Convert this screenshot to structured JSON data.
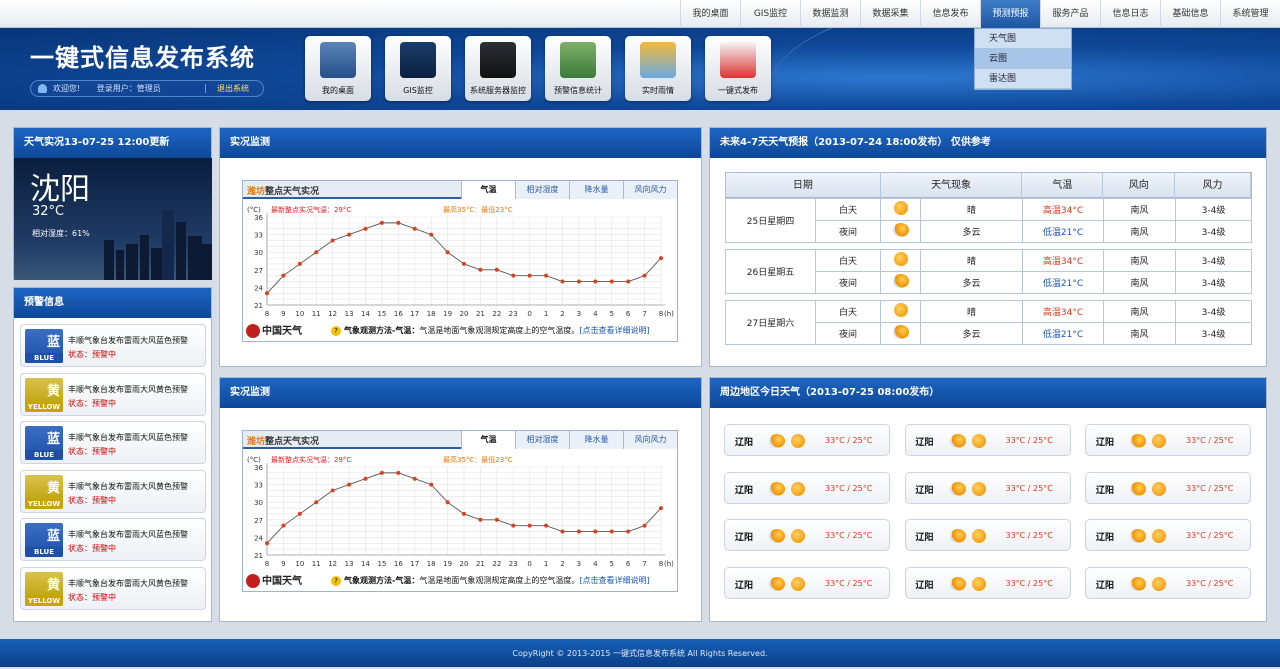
{
  "topnav": {
    "items": [
      "我的桌面",
      "GIS监控",
      "数据监测",
      "数据采集",
      "信息发布",
      "预测预报",
      "服务产品",
      "信息日志",
      "基础信息",
      "系统管理"
    ],
    "active_index": 5,
    "dropdown": [
      "天气图",
      "云图",
      "雷达图"
    ],
    "dropdown_selected_index": 1
  },
  "header": {
    "title": "一键式信息发布系统",
    "welcome": "欢迎您!",
    "user_label": "登录用户：管理员",
    "logout": "退出系统"
  },
  "tiles": [
    {
      "label": "我的桌面",
      "icon": "desktop-check-icon"
    },
    {
      "label": "GIS监控",
      "icon": "globe-map-icon"
    },
    {
      "label": "系统服务器监控",
      "icon": "server-monitor-icon"
    },
    {
      "label": "预警信息统计",
      "icon": "chart-stats-icon"
    },
    {
      "label": "实时雨情",
      "icon": "weather-rain-icon"
    },
    {
      "label": "一键式发布",
      "icon": "pencil-edit-icon"
    }
  ],
  "current": {
    "header": "天气实况13-07-25 12:00更新",
    "city": "沈阳",
    "temp": "32°C",
    "humidity": "相对湿度：61%"
  },
  "warnings": {
    "header": "预警信息",
    "items": [
      {
        "text": "丰顺气象台发布雷雨大风蓝色预警",
        "status": "状态：预警中",
        "level": "BLUE",
        "level_cn": "蓝"
      },
      {
        "text": "丰顺气象台发布雷雨大风黄色预警",
        "status": "状态：预警中",
        "level": "YELLOW",
        "level_cn": "黄"
      },
      {
        "text": "丰顺气象台发布雷雨大风蓝色预警",
        "status": "状态：预警中",
        "level": "BLUE",
        "level_cn": "蓝"
      },
      {
        "text": "丰顺气象台发布雷雨大风黄色预警",
        "status": "状态：预警中",
        "level": "YELLOW",
        "level_cn": "黄"
      },
      {
        "text": "丰顺气象台发布雷雨大风蓝色预警",
        "status": "状态：预警中",
        "level": "BLUE",
        "level_cn": "蓝"
      },
      {
        "text": "丰顺气象台发布雷雨大风黄色预警",
        "status": "状态：预警中",
        "level": "YELLOW",
        "level_cn": "黄"
      }
    ],
    "colors": {
      "BLUE": "#1d4fa8",
      "YELLOW": "#c9a400"
    }
  },
  "monitor": {
    "panels": [
      {
        "header": "实况监测",
        "chart_title_city": "潍坊",
        "chart_title_rest": "整点天气实况",
        "tabs": [
          "气温",
          "相对湿度",
          "降水量",
          "风向风力"
        ],
        "latest": "最新整点实况气温：29°C",
        "range": "最高35°C：最低23°C",
        "brand": "中国天气",
        "note_prefix": "气象观测方法-气温：",
        "note_body": "气温是地面气象观测规定高度上的空气温度。",
        "note_link": "[点击查看详细说明]"
      },
      {
        "header": "实况监测",
        "chart_title_city": "潍坊",
        "chart_title_rest": "整点天气实况",
        "tabs": [
          "气温",
          "相对湿度",
          "降水量",
          "风向风力"
        ],
        "latest": "最新整点实况气温：29°C",
        "range": "最高35°C：最低23°C",
        "brand": "中国天气",
        "note_prefix": "气象观测方法-气温：",
        "note_body": "气温是地面气象观测规定高度上的空气温度。",
        "note_link": "[点击查看详细说明]"
      }
    ]
  },
  "chart_data": [
    {
      "type": "line",
      "title": "潍坊整点天气实况",
      "ylabel": "(°C)",
      "xlabel": "(h)",
      "x": [
        "8",
        "9",
        "10",
        "11",
        "12",
        "13",
        "14",
        "15",
        "16",
        "17",
        "18",
        "19",
        "20",
        "21",
        "22",
        "23",
        "0",
        "1",
        "2",
        "3",
        "4",
        "5",
        "6",
        "7",
        "8"
      ],
      "values": [
        23,
        26,
        28,
        30,
        32,
        33,
        34,
        35,
        35,
        34,
        33,
        30,
        28,
        27,
        27,
        26,
        26,
        26,
        25,
        25,
        25,
        25,
        25,
        26,
        29
      ],
      "ylim": [
        21,
        36
      ],
      "yticks": [
        21,
        24,
        27,
        30,
        33,
        36
      ],
      "grid": true,
      "colors": {
        "line": "#555555",
        "point": "#d9421e"
      }
    },
    {
      "type": "line",
      "title": "潍坊整点天气实况",
      "ylabel": "(°C)",
      "xlabel": "(h)",
      "x": [
        "8",
        "9",
        "10",
        "11",
        "12",
        "13",
        "14",
        "15",
        "16",
        "17",
        "18",
        "19",
        "20",
        "21",
        "22",
        "23",
        "0",
        "1",
        "2",
        "3",
        "4",
        "5",
        "6",
        "7",
        "8"
      ],
      "values": [
        23,
        26,
        28,
        30,
        32,
        33,
        34,
        35,
        35,
        34,
        33,
        30,
        28,
        27,
        27,
        26,
        26,
        26,
        25,
        25,
        25,
        25,
        25,
        26,
        29
      ],
      "ylim": [
        21,
        36
      ],
      "yticks": [
        21,
        24,
        27,
        30,
        33,
        36
      ],
      "grid": true,
      "colors": {
        "line": "#555555",
        "point": "#d9421e"
      }
    }
  ],
  "forecast": {
    "header": "未来4-7天天气预报（2013-07-24  18:00发布）      仅供参考",
    "columns": [
      "日期",
      "天气现象",
      "气温",
      "风向",
      "风力"
    ],
    "days": [
      {
        "date": "25日星期四",
        "rows": [
          {
            "period": "白天",
            "icon": "sun-icon",
            "weather": "晴",
            "temp": "高温34°C",
            "wind_dir": "南风",
            "wind": "3-4级"
          },
          {
            "period": "夜间",
            "icon": "cloud-sun-icon",
            "weather": "多云",
            "temp": "低温21°C",
            "wind_dir": "南风",
            "wind": "3-4级"
          }
        ]
      },
      {
        "date": "26日星期五",
        "rows": [
          {
            "period": "白天",
            "icon": "sun-icon",
            "weather": "晴",
            "temp": "高温34°C",
            "wind_dir": "南风",
            "wind": "3-4级"
          },
          {
            "period": "夜间",
            "icon": "cloud-sun-icon",
            "weather": "多云",
            "temp": "低温21°C",
            "wind_dir": "南风",
            "wind": "3-4级"
          }
        ]
      },
      {
        "date": "27日星期六",
        "rows": [
          {
            "period": "白天",
            "icon": "sun-icon",
            "weather": "晴",
            "temp": "高温34°C",
            "wind_dir": "南风",
            "wind": "3-4级"
          },
          {
            "period": "夜间",
            "icon": "cloud-sun-icon",
            "weather": "多云",
            "temp": "低温21°C",
            "wind_dir": "南风",
            "wind": "3-4级"
          }
        ]
      }
    ],
    "colors": {
      "high": "#e0351b",
      "low": "#1c55b5"
    }
  },
  "nearby": {
    "header": "周边地区今日天气（2013-07-25   08:00发布）",
    "items": [
      {
        "city": "辽阳",
        "temp": "33°C / 25°C"
      },
      {
        "city": "辽阳",
        "temp": "33°C / 25°C"
      },
      {
        "city": "辽阳",
        "temp": "33°C / 25°C"
      },
      {
        "city": "辽阳",
        "temp": "33°C / 25°C"
      },
      {
        "city": "辽阳",
        "temp": "33°C / 25°C"
      },
      {
        "city": "辽阳",
        "temp": "33°C / 25°C"
      },
      {
        "city": "辽阳",
        "temp": "33°C / 25°C"
      },
      {
        "city": "辽阳",
        "temp": "33°C / 25°C"
      },
      {
        "city": "辽阳",
        "temp": "33°C / 25°C"
      },
      {
        "city": "辽阳",
        "temp": "33°C / 25°C"
      },
      {
        "city": "辽阳",
        "temp": "33°C / 25°C"
      },
      {
        "city": "辽阳",
        "temp": "33°C / 25°C"
      }
    ],
    "temp_color": "#e0351b"
  },
  "footer": "CopyRight © 2013-2015 一键式信息发布系统 All Rights Reserved."
}
